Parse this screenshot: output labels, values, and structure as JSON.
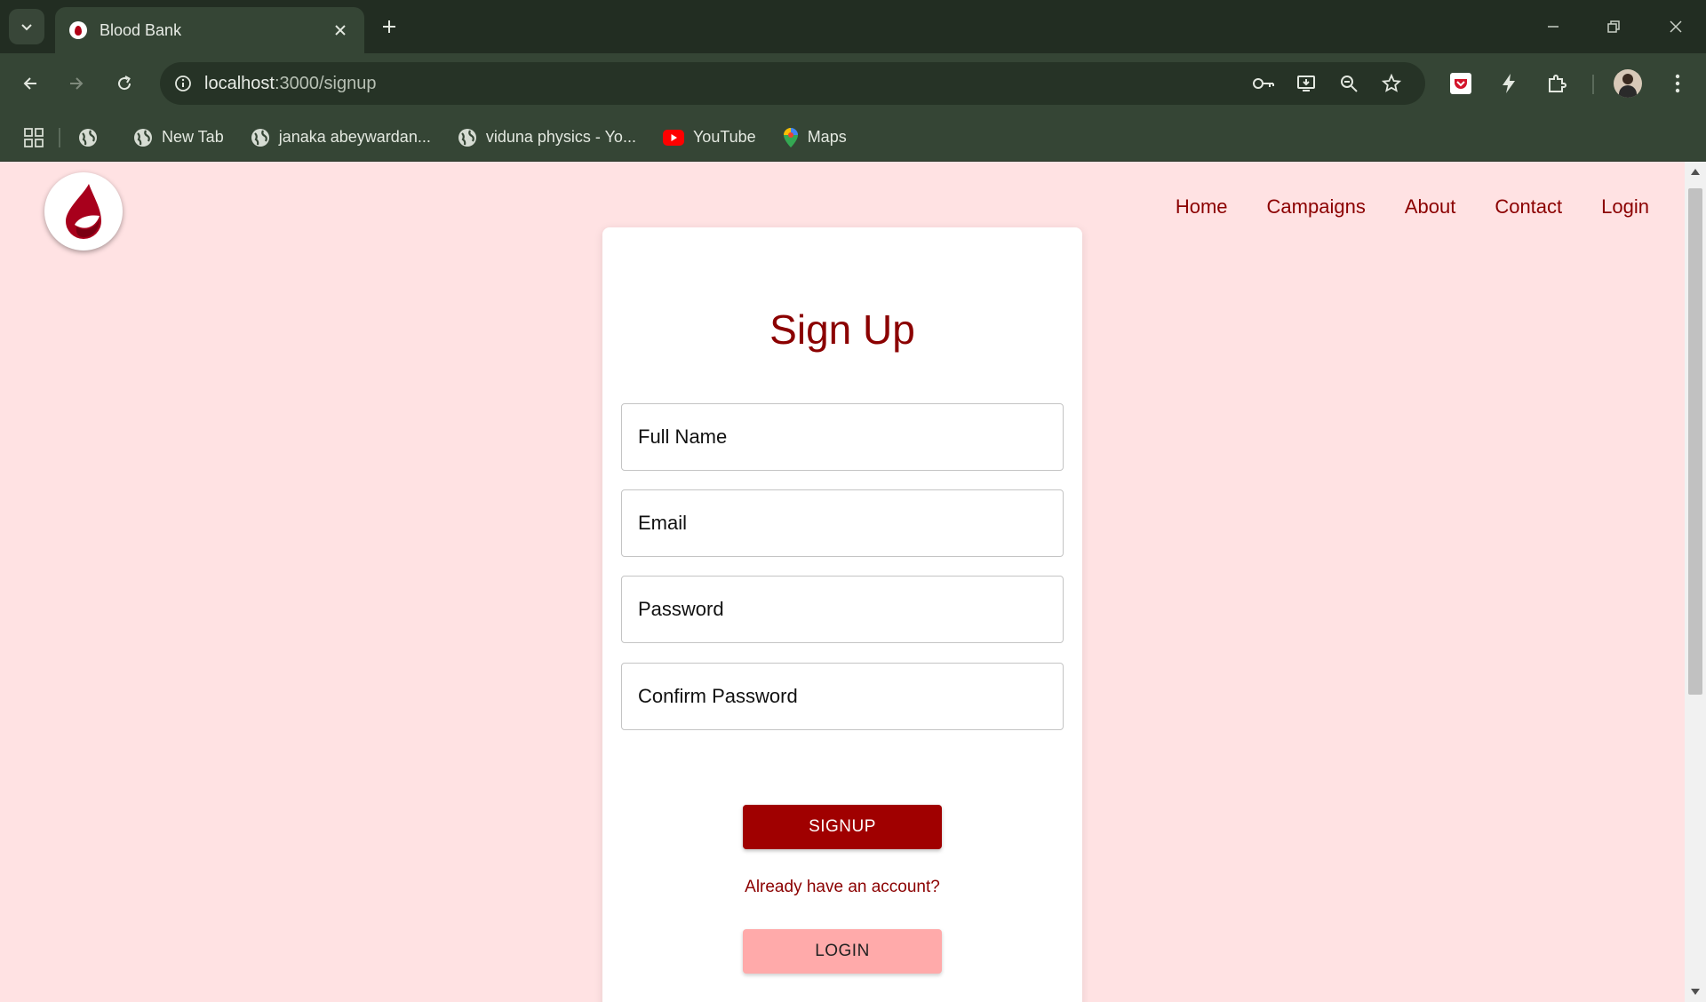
{
  "browser": {
    "tab_title": "Blood Bank",
    "url_host": "localhost",
    "url_rest": ":3000/signup",
    "bookmarks": [
      {
        "label": "",
        "icon": "globe-icon"
      },
      {
        "label": "New Tab",
        "icon": "globe-icon"
      },
      {
        "label": "janaka abeywardan...",
        "icon": "globe-icon"
      },
      {
        "label": "viduna physics - Yo...",
        "icon": "globe-icon"
      },
      {
        "label": "YouTube",
        "icon": "youtube-icon"
      },
      {
        "label": "Maps",
        "icon": "maps-icon"
      }
    ],
    "colors": {
      "frame": "#222d22",
      "toolbar": "#354535",
      "omnibox": "#263326"
    }
  },
  "site": {
    "nav": [
      "Home",
      "Campaigns",
      "About",
      "Contact",
      "Login"
    ],
    "colors": {
      "background": "#ffe2e3",
      "brand": "#8b0000",
      "primary_button": "#a00000",
      "secondary_button": "#ffaaaa"
    }
  },
  "form": {
    "title": "Sign Up",
    "fields": [
      {
        "placeholder": "Full Name"
      },
      {
        "placeholder": "Email"
      },
      {
        "placeholder": "Password"
      },
      {
        "placeholder": "Confirm Password"
      }
    ],
    "signup_label": "SIGNUP",
    "already_text": "Already have an account?",
    "login_label": "LOGIN"
  }
}
